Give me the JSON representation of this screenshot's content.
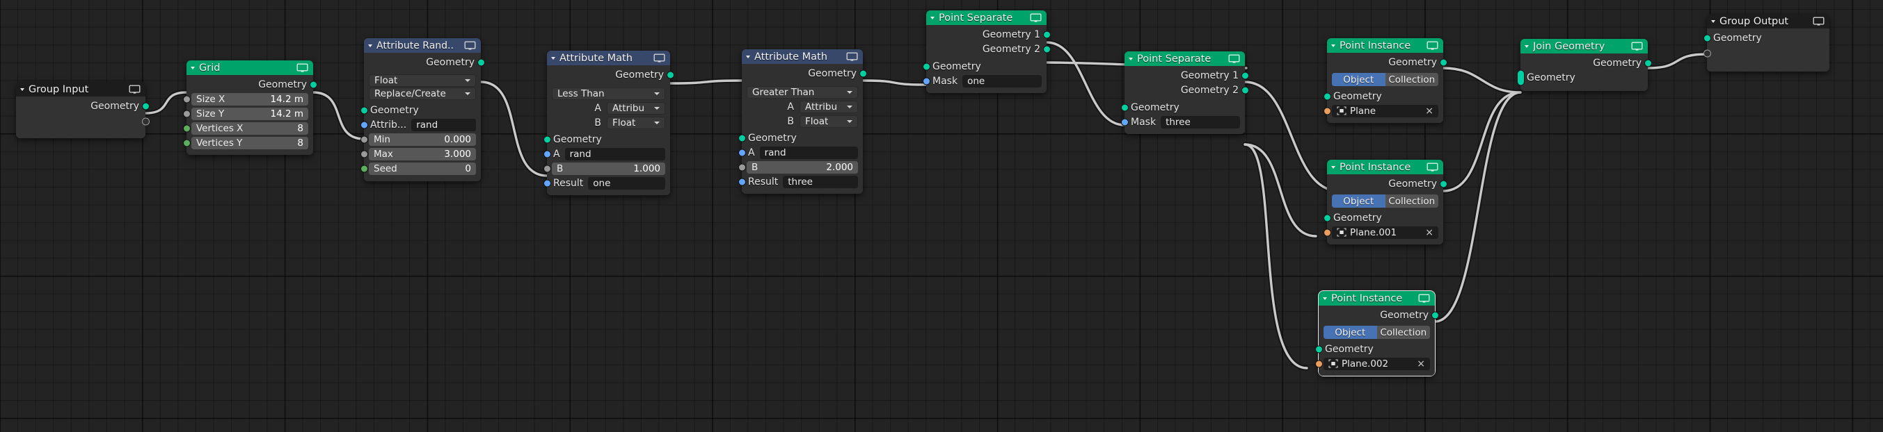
{
  "app": {
    "editor": "Geometry Node Editor",
    "background_color": "#232323",
    "grid_line_color": "#1a1a1a",
    "wire_color": "#c8c8c8",
    "socket_colors": {
      "geometry": "#00cf9f",
      "attribute": "#63a6ff",
      "value": "#9a9a9a",
      "integer": "#5daf5d",
      "object": "#ed9e5c"
    },
    "header_colors": {
      "geometry_node": "#00a46b",
      "attribute_node": "#38486b",
      "group_io_node": "#1c1c1c"
    }
  },
  "nodes": [
    {
      "id": "group-input",
      "title": "Group Input",
      "header_style": "gray",
      "outputs": [
        {
          "label": "Geometry",
          "socket": "geo"
        },
        {
          "label": "",
          "socket": "hollow"
        }
      ]
    },
    {
      "id": "grid",
      "title": "Grid",
      "header_style": "green",
      "outputs": [
        {
          "label": "Geometry",
          "socket": "geo"
        }
      ],
      "fields": [
        {
          "kind": "slider",
          "label": "Size X",
          "value": "14.2 m",
          "socket": "val"
        },
        {
          "kind": "slider",
          "label": "Size Y",
          "value": "14.2 m",
          "socket": "val"
        },
        {
          "kind": "slider",
          "label": "Vertices X",
          "value": "8",
          "socket": "green"
        },
        {
          "kind": "slider",
          "label": "Vertices Y",
          "value": "8",
          "socket": "green"
        }
      ]
    },
    {
      "id": "attribute-randomize",
      "title": "Attribute Rand..",
      "header_style": "blue",
      "outputs": [
        {
          "label": "Geometry",
          "socket": "geo"
        }
      ],
      "dropdowns": [
        {
          "value": "Float"
        },
        {
          "value": "Replace/Create"
        }
      ],
      "inputs": [
        {
          "label": "Geometry",
          "socket": "geo"
        },
        {
          "label": "Attrib...",
          "socket": "attr",
          "value": "rand"
        }
      ],
      "fields": [
        {
          "kind": "slider",
          "label": "Min",
          "value": "0.000",
          "socket": "val"
        },
        {
          "kind": "slider",
          "label": "Max",
          "value": "3.000",
          "socket": "val"
        },
        {
          "kind": "slider",
          "label": "Seed",
          "value": "0",
          "socket": "green"
        }
      ]
    },
    {
      "id": "attribute-math-1",
      "title": "Attribute Math",
      "header_style": "blue",
      "outputs": [
        {
          "label": "Geometry",
          "socket": "geo"
        }
      ],
      "operation": "Less Than",
      "type_a": {
        "label": "A",
        "value": "Attribu"
      },
      "type_b": {
        "label": "B",
        "value": "Float"
      },
      "inputs": [
        {
          "label": "Geometry",
          "socket": "geo"
        },
        {
          "label": "A",
          "socket": "attr",
          "value": "rand"
        },
        {
          "label": "B",
          "socket": "val",
          "value": "1.000",
          "slider": true
        },
        {
          "label": "Result",
          "socket": "attr",
          "value": "one"
        }
      ]
    },
    {
      "id": "attribute-math-2",
      "title": "Attribute Math",
      "header_style": "blue",
      "outputs": [
        {
          "label": "Geometry",
          "socket": "geo"
        }
      ],
      "operation": "Greater Than",
      "type_a": {
        "label": "A",
        "value": "Attribu"
      },
      "type_b": {
        "label": "B",
        "value": "Float"
      },
      "inputs": [
        {
          "label": "Geometry",
          "socket": "geo"
        },
        {
          "label": "A",
          "socket": "attr",
          "value": "rand"
        },
        {
          "label": "B",
          "socket": "val",
          "value": "2.000",
          "slider": true
        },
        {
          "label": "Result",
          "socket": "attr",
          "value": "three"
        }
      ]
    },
    {
      "id": "point-separate-1",
      "title": "Point Separate",
      "header_style": "green",
      "outputs": [
        {
          "label": "Geometry 1",
          "socket": "geo"
        },
        {
          "label": "Geometry 2",
          "socket": "geo"
        }
      ],
      "inputs": [
        {
          "label": "Geometry",
          "socket": "geo"
        },
        {
          "label": "Mask",
          "socket": "attr",
          "value": "one"
        }
      ]
    },
    {
      "id": "point-separate-2",
      "title": "Point Separate",
      "header_style": "green",
      "outputs": [
        {
          "label": "Geometry 1",
          "socket": "geo"
        },
        {
          "label": "Geometry 2",
          "socket": "geo"
        }
      ],
      "inputs": [
        {
          "label": "Geometry",
          "socket": "geo"
        },
        {
          "label": "Mask",
          "socket": "attr",
          "value": "three"
        }
      ]
    },
    {
      "id": "point-instance-1",
      "title": "Point Instance",
      "header_style": "green",
      "outputs": [
        {
          "label": "Geometry",
          "socket": "geo"
        }
      ],
      "toggle": {
        "on": "Object",
        "off": "Collection"
      },
      "inputs": [
        {
          "label": "Geometry",
          "socket": "geo"
        }
      ],
      "object": {
        "name": "Plane",
        "close": "×"
      }
    },
    {
      "id": "point-instance-2",
      "title": "Point Instance",
      "header_style": "green",
      "outputs": [
        {
          "label": "Geometry",
          "socket": "geo"
        }
      ],
      "toggle": {
        "on": "Object",
        "off": "Collection"
      },
      "inputs": [
        {
          "label": "Geometry",
          "socket": "geo"
        }
      ],
      "object": {
        "name": "Plane.001",
        "close": "×"
      }
    },
    {
      "id": "point-instance-3",
      "title": "Point Instance",
      "header_style": "green",
      "selected": true,
      "outputs": [
        {
          "label": "Geometry",
          "socket": "geo"
        }
      ],
      "toggle": {
        "on": "Object",
        "off": "Collection"
      },
      "inputs": [
        {
          "label": "Geometry",
          "socket": "geo"
        }
      ],
      "object": {
        "name": "Plane.002",
        "close": "×"
      }
    },
    {
      "id": "join-geometry",
      "title": "Join Geometry",
      "header_style": "green",
      "outputs": [
        {
          "label": "Geometry",
          "socket": "geo"
        }
      ],
      "inputs": [
        {
          "label": "Geometry",
          "socket": "geo-multi"
        }
      ]
    },
    {
      "id": "group-output",
      "title": "Group Output",
      "header_style": "gray",
      "inputs": [
        {
          "label": "Geometry",
          "socket": "geo"
        },
        {
          "label": "",
          "socket": "hollow"
        }
      ]
    }
  ]
}
